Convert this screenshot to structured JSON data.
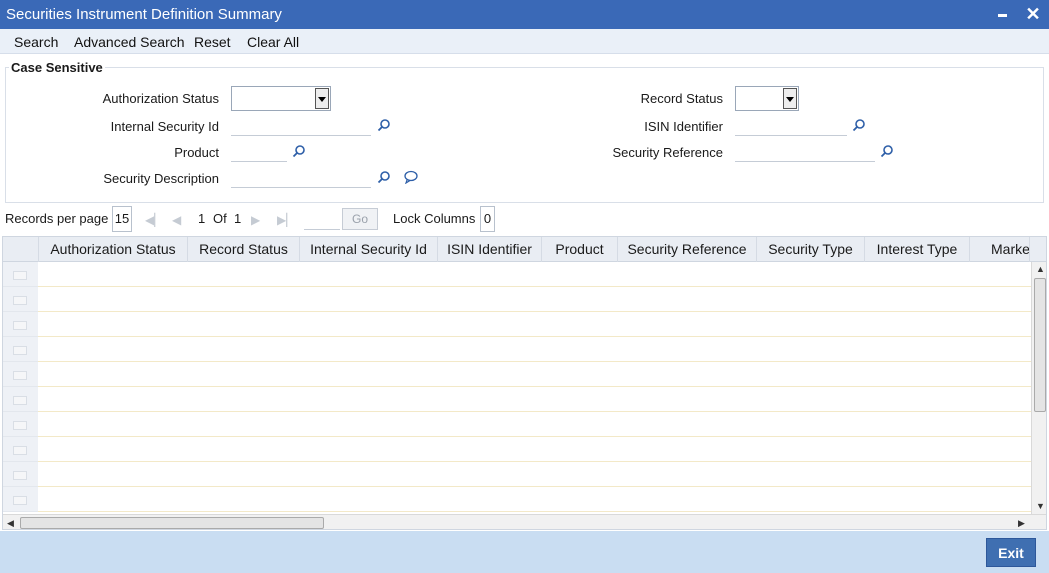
{
  "window": {
    "title": "Securities Instrument Definition Summary",
    "minimize_glyph": "",
    "close_glyph": "✕"
  },
  "toolbar": {
    "search": "Search",
    "advanced_search": "Advanced Search",
    "reset": "Reset",
    "clear_all": "Clear All"
  },
  "criteria": {
    "legend": "Case Sensitive",
    "authorization_status": {
      "label": "Authorization Status",
      "value": ""
    },
    "record_status": {
      "label": "Record Status",
      "value": ""
    },
    "internal_security_id": {
      "label": "Internal Security Id",
      "value": ""
    },
    "isin_identifier": {
      "label": "ISIN Identifier",
      "value": ""
    },
    "product": {
      "label": "Product",
      "value": ""
    },
    "security_reference": {
      "label": "Security Reference",
      "value": ""
    },
    "security_description": {
      "label": "Security Description",
      "value": ""
    }
  },
  "pager": {
    "records_per_page_label": "Records per page",
    "records_per_page": "15",
    "current_page": "1",
    "of_label": "Of",
    "total_pages": "1",
    "go_label": "Go",
    "lock_columns_label": "Lock Columns",
    "lock_columns": "0"
  },
  "grid": {
    "columns": [
      "Authorization Status",
      "Record Status",
      "Internal Security Id",
      "ISIN Identifier",
      "Product",
      "Security Reference",
      "Security Type",
      "Interest Type",
      "Market"
    ],
    "rows": []
  },
  "footer": {
    "exit_label": "Exit"
  },
  "colors": {
    "title_bar": "#3a69b7",
    "footer": "#c9ddf2",
    "exit_button": "#3f6fb1"
  }
}
